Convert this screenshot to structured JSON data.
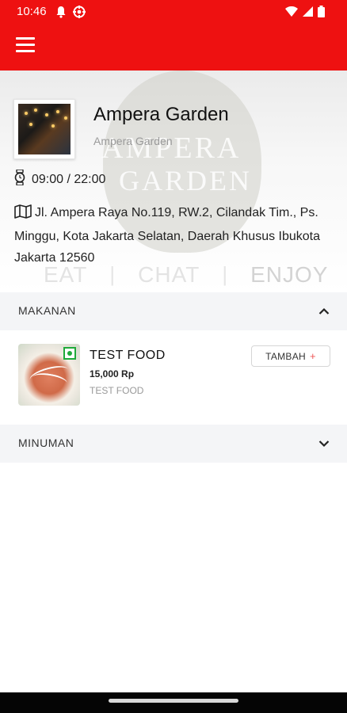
{
  "status_bar": {
    "time": "10:46"
  },
  "restaurant": {
    "name": "Ampera Garden",
    "subtitle": "Ampera Garden",
    "hours": "09:00 / 22:00",
    "address": "Jl. Ampera Raya No.119, RW.2, Cilandak Tim., Ps. Minggu, Kota Jakarta Selatan, Daerah Khusus Ibukota Jakarta 12560"
  },
  "hero": {
    "logo_line1": "AMPERA",
    "logo_line2": "GARDEN",
    "tagline": [
      "EAT",
      "CHAT",
      "ENJOY"
    ],
    "separator": "|"
  },
  "sections": [
    {
      "label": "MAKANAN",
      "expanded": true,
      "items": [
        {
          "name": "TEST FOOD",
          "price": "15,000 Rp",
          "description": "TEST FOOD",
          "add_label": "TAMBAH",
          "add_icon": "+"
        }
      ]
    },
    {
      "label": "MINUMAN",
      "expanded": false,
      "items": []
    }
  ],
  "colors": {
    "accent": "#ee1111",
    "veg_badge": "#1faa3a",
    "section_bg": "#f4f5f7"
  },
  "icons": {
    "status": [
      "bell-icon",
      "gear-icon",
      "wifi-icon",
      "signal-icon",
      "battery-icon"
    ],
    "menu": "hamburger-menu-icon",
    "hours": "watch-icon",
    "address": "map-icon"
  }
}
